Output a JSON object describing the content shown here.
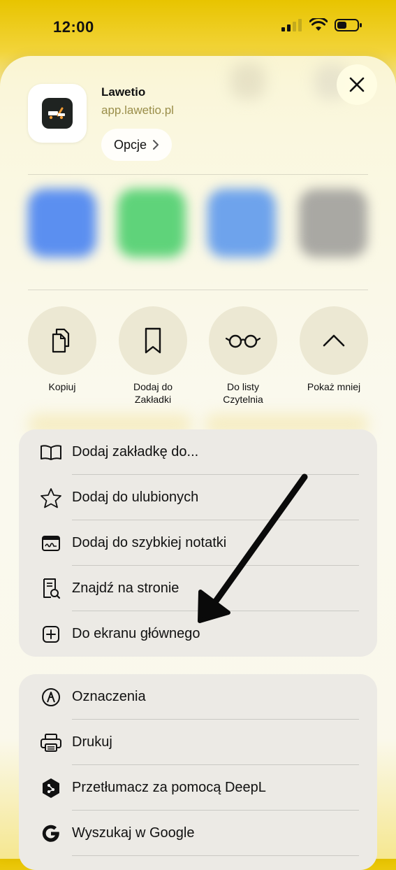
{
  "status_bar": {
    "time": "12:00"
  },
  "app": {
    "name": "Lawetio",
    "url": "app.lawetio.pl"
  },
  "options": {
    "label": "Opcje"
  },
  "actions": [
    {
      "label": "Kopiuj",
      "icon": "copy-icon"
    },
    {
      "label": "Dodaj do\nZakładki",
      "icon": "bookmark-icon"
    },
    {
      "label": "Do listy\nCzytelnia",
      "icon": "glasses-icon"
    },
    {
      "label": "Pokaż mniej",
      "icon": "chevron-up-icon"
    }
  ],
  "menu_group_1": [
    {
      "label": "Dodaj zakładkę do...",
      "icon": "book-icon"
    },
    {
      "label": "Dodaj do ulubionych",
      "icon": "star-icon"
    },
    {
      "label": "Dodaj do szybkiej notatki",
      "icon": "quick-note-icon"
    },
    {
      "label": "Znajdź na stronie",
      "icon": "find-on-page-icon"
    },
    {
      "label": "Do ekranu głównego",
      "icon": "add-square-icon"
    }
  ],
  "menu_group_2": [
    {
      "label": "Oznaczenia",
      "icon": "markup-icon"
    },
    {
      "label": "Drukuj",
      "icon": "printer-icon"
    },
    {
      "label": "Przetłumacz za pomocą DeepL",
      "icon": "deepl-icon"
    },
    {
      "label": "Wyszukaj w Google",
      "icon": "google-icon"
    }
  ],
  "colors": {
    "accent_yellow": "#f2d43a",
    "sheet_background": "#fbf9ef",
    "menu_group_background": "#eceae5",
    "app_url_color": "#9a8e4a"
  }
}
